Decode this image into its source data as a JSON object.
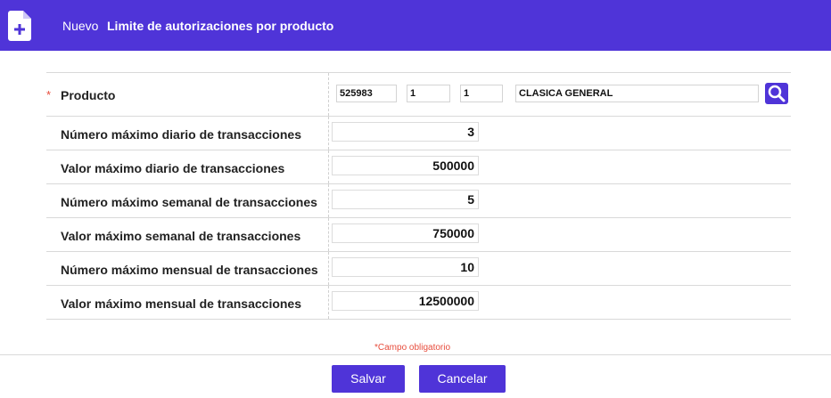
{
  "header": {
    "subtitle": "Nuevo",
    "title": "Limite de autorizaciones por producto",
    "accent_color": "#4f34d8",
    "icon": "document-plus-icon"
  },
  "form": {
    "product": {
      "required_mark": "*",
      "label": "Producto",
      "code": "525983",
      "field2": "1",
      "field3": "1",
      "description": "CLASICA GENERAL",
      "search_icon": "search-icon"
    },
    "rows": [
      {
        "label": "Número máximo diario de transacciones",
        "value": "3"
      },
      {
        "label": "Valor máximo diario de transacciones",
        "value": "500000"
      },
      {
        "label": "Número máximo semanal de transacciones",
        "value": "5"
      },
      {
        "label": "Valor máximo semanal de transacciones",
        "value": "750000"
      },
      {
        "label": "Número máximo mensual de transacciones",
        "value": "10"
      },
      {
        "label": "Valor máximo mensual de transacciones",
        "value": "12500000"
      }
    ]
  },
  "footer": {
    "required_note": "*Campo obligatorio",
    "save_label": "Salvar",
    "cancel_label": "Cancelar"
  }
}
